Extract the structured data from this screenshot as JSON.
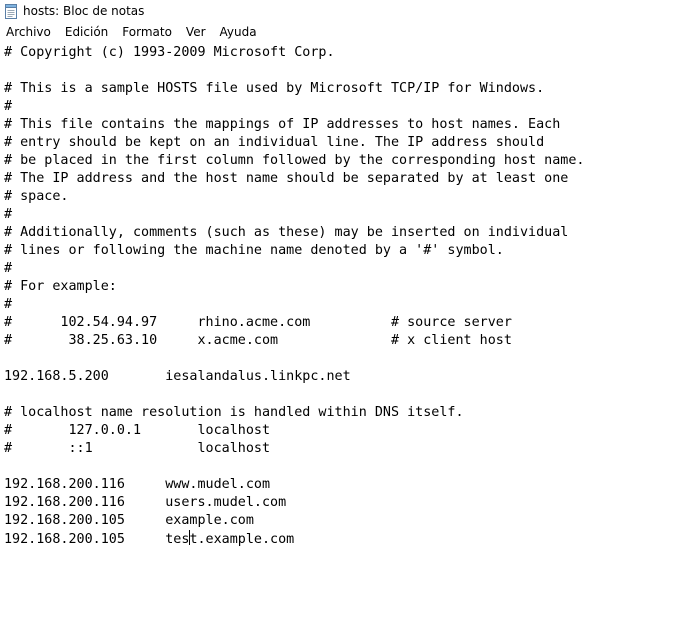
{
  "window": {
    "title": "hosts: Bloc de notas",
    "icon": "notepad-icon"
  },
  "menu": {
    "items": [
      "Archivo",
      "Edición",
      "Formato",
      "Ver",
      "Ayuda"
    ]
  },
  "document": {
    "lines": [
      "# Copyright (c) 1993-2009 Microsoft Corp.",
      "",
      "# This is a sample HOSTS file used by Microsoft TCP/IP for Windows.",
      "#",
      "# This file contains the mappings of IP addresses to host names. Each",
      "# entry should be kept on an individual line. The IP address should",
      "# be placed in the first column followed by the corresponding host name.",
      "# The IP address and the host name should be separated by at least one",
      "# space.",
      "#",
      "# Additionally, comments (such as these) may be inserted on individual",
      "# lines or following the machine name denoted by a '#' symbol.",
      "#",
      "# For example:",
      "#",
      "#      102.54.94.97     rhino.acme.com          # source server",
      "#       38.25.63.10     x.acme.com              # x client host",
      "",
      "192.168.5.200       iesalandalus.linkpc.net",
      "",
      "# localhost name resolution is handled within DNS itself.",
      "#       127.0.0.1       localhost",
      "#       ::1             localhost",
      "",
      "192.168.200.116     www.mudel.com",
      "192.168.200.116     users.mudel.com",
      "192.168.200.105     example.com",
      "192.168.200.105     test.example.com"
    ],
    "caret": {
      "line": 27,
      "column": 23
    }
  }
}
